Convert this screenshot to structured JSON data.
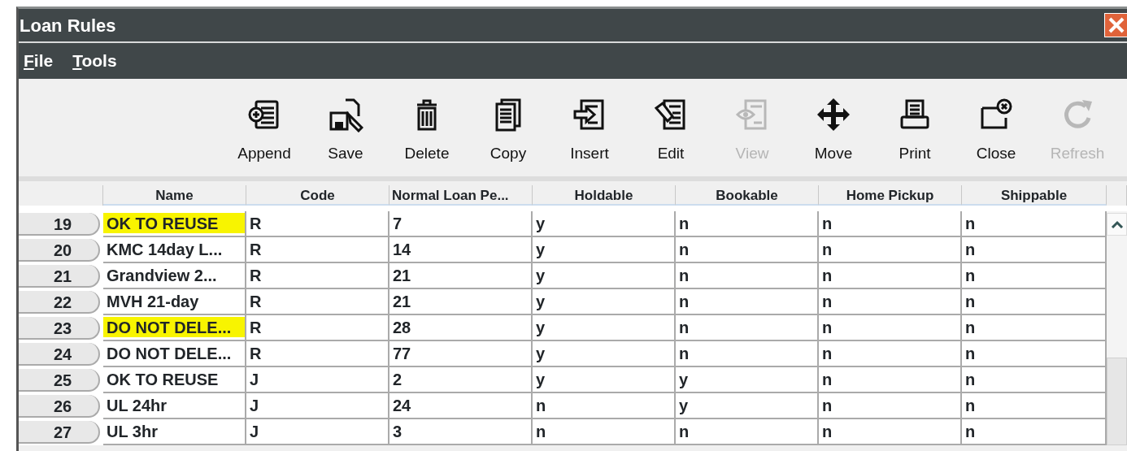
{
  "window": {
    "title": "Loan Rules"
  },
  "menu": [
    {
      "label": "File"
    },
    {
      "label": "Tools"
    }
  ],
  "toolbar": [
    {
      "label": "Append",
      "disabled": false
    },
    {
      "label": "Save",
      "disabled": false
    },
    {
      "label": "Delete",
      "disabled": false
    },
    {
      "label": "Copy",
      "disabled": false
    },
    {
      "label": "Insert",
      "disabled": false
    },
    {
      "label": "Edit",
      "disabled": false
    },
    {
      "label": "View",
      "disabled": true
    },
    {
      "label": "Move",
      "disabled": false
    },
    {
      "label": "Print",
      "disabled": false
    },
    {
      "label": "Close",
      "disabled": false
    },
    {
      "label": "Refresh",
      "disabled": true
    }
  ],
  "table": {
    "columns": [
      "Name",
      "Code",
      "Normal Loan Pe...",
      "Holdable",
      "Bookable",
      "Home Pickup",
      "Shippable"
    ],
    "rows": [
      {
        "number": "19",
        "highlighted": true,
        "cells": [
          "OK TO REUSE",
          "R",
          "7",
          "y",
          "n",
          "n",
          "n"
        ]
      },
      {
        "number": "20",
        "highlighted": false,
        "cells": [
          "KMC 14day L...",
          "R",
          "14",
          "y",
          "n",
          "n",
          "n"
        ]
      },
      {
        "number": "21",
        "highlighted": false,
        "cells": [
          "Grandview 2...",
          "R",
          "21",
          "y",
          "n",
          "n",
          "n"
        ]
      },
      {
        "number": "22",
        "highlighted": false,
        "cells": [
          "MVH 21-day",
          "R",
          "21",
          "y",
          "n",
          "n",
          "n"
        ]
      },
      {
        "number": "23",
        "highlighted": true,
        "cells": [
          "DO NOT DELE...",
          "R",
          "28",
          "y",
          "n",
          "n",
          "n"
        ]
      },
      {
        "number": "24",
        "highlighted": false,
        "cells": [
          "DO NOT DELE...",
          "R",
          "77",
          "y",
          "n",
          "n",
          "n"
        ]
      },
      {
        "number": "25",
        "highlighted": false,
        "cells": [
          "OK TO REUSE",
          "J",
          "2",
          "y",
          "y",
          "n",
          "n"
        ]
      },
      {
        "number": "26",
        "highlighted": false,
        "cells": [
          "UL 24hr",
          "J",
          "24",
          "n",
          "y",
          "n",
          "n"
        ]
      },
      {
        "number": "27",
        "highlighted": false,
        "cells": [
          "UL 3hr",
          "J",
          "3",
          "n",
          "n",
          "n",
          "n"
        ]
      }
    ]
  }
}
